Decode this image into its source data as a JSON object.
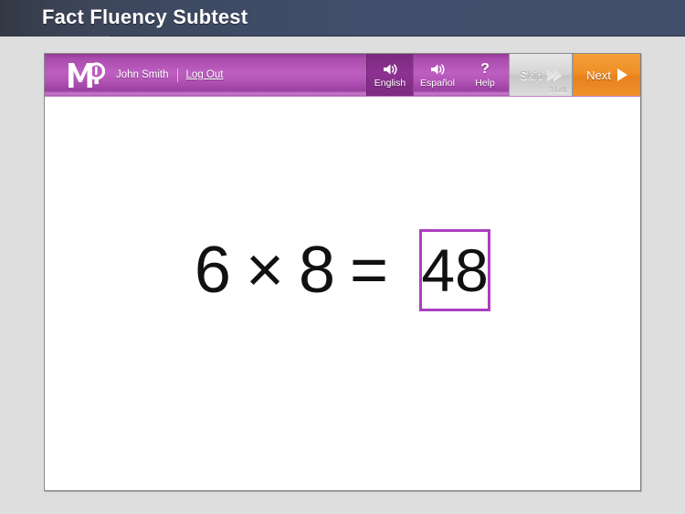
{
  "header": {
    "title": "Fact Fluency Subtest",
    "bg_color": "#3d485e",
    "text_color": "#ffffff"
  },
  "page": {
    "background_color": "#dedede",
    "panel_background": "#ffffff"
  },
  "toolbar": {
    "background_color": "#b455b8",
    "logo_name": "mq-logo",
    "user_name": "John Smith",
    "divider": "|",
    "logout_label": "Log Out",
    "buttons": [
      {
        "label": "English",
        "icon": "speaker-icon",
        "state": "active"
      },
      {
        "label": "Español",
        "icon": "speaker-icon",
        "state": "default"
      },
      {
        "label": "Help",
        "icon": "question-mark-icon",
        "state": "default"
      }
    ],
    "skip": {
      "label": "Skip",
      "icon": "double-chevron-right-icon",
      "remaining_label": "3 Left",
      "state": "disabled",
      "background_color": "#d4d4d4"
    },
    "next": {
      "label": "Next",
      "icon": "play-triangle-icon",
      "background_color": "#ef8f26"
    }
  },
  "question": {
    "operand_left": "6",
    "operator": "×",
    "operand_right": "8",
    "equals": "=",
    "answer_value": "48",
    "answer_box_border_color": "#aa3fc0"
  }
}
